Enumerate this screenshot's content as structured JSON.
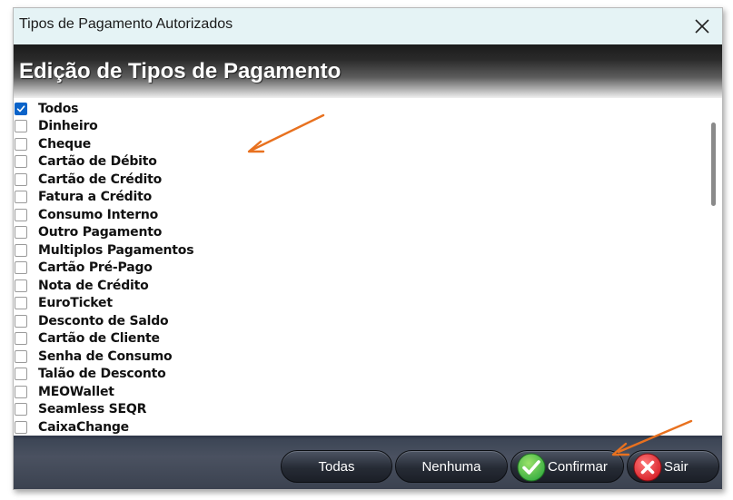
{
  "dialog": {
    "title": "Tipos de Pagamento Autorizados",
    "close_icon": "close-icon"
  },
  "header": {
    "title": "Edição de Tipos de Pagamento"
  },
  "payment_types": [
    {
      "label": "Todos",
      "checked": true
    },
    {
      "label": "Dinheiro",
      "checked": false
    },
    {
      "label": "Cheque",
      "checked": false
    },
    {
      "label": "Cartão de Débito",
      "checked": false
    },
    {
      "label": "Cartão de Crédito",
      "checked": false
    },
    {
      "label": "Fatura a Crédito",
      "checked": false
    },
    {
      "label": "Consumo Interno",
      "checked": false
    },
    {
      "label": "Outro Pagamento",
      "checked": false
    },
    {
      "label": "Multiplos Pagamentos",
      "checked": false
    },
    {
      "label": "Cartão Pré-Pago",
      "checked": false
    },
    {
      "label": "Nota de Crédito",
      "checked": false
    },
    {
      "label": "EuroTicket",
      "checked": false
    },
    {
      "label": "Desconto de Saldo",
      "checked": false
    },
    {
      "label": "Cartão de Cliente",
      "checked": false
    },
    {
      "label": "Senha de Consumo",
      "checked": false
    },
    {
      "label": "Talão de Desconto",
      "checked": false
    },
    {
      "label": "MEOWallet",
      "checked": false
    },
    {
      "label": "Seamless SEQR",
      "checked": false
    },
    {
      "label": "CaixaChange",
      "checked": false
    }
  ],
  "footer": {
    "todas_label": "Todas",
    "nenhuma_label": "Nenhuma",
    "confirmar_label": "Confirmar",
    "sair_label": "Sair"
  },
  "colors": {
    "checkbox_checked": "#0a63c9",
    "confirm_icon": "#3cb043",
    "exit_icon": "#d8242c",
    "annotation_arrow": "#e8711f"
  }
}
